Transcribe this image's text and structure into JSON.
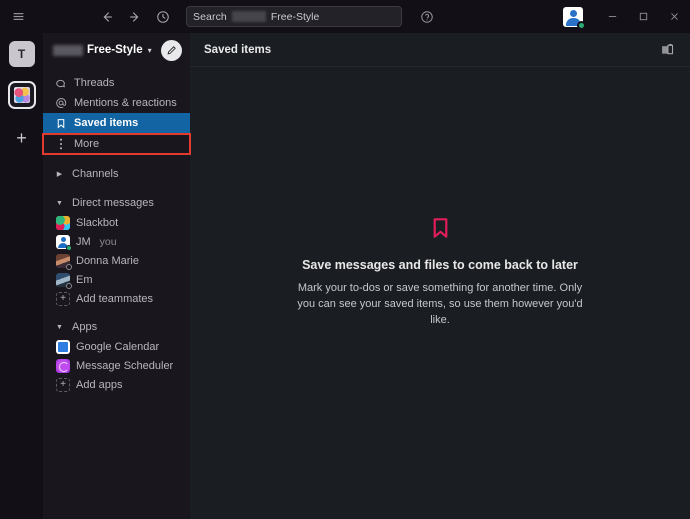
{
  "window": {
    "menu_icon": "hamburger-icon",
    "back_icon": "arrow-left-icon",
    "forward_icon": "arrow-right-icon",
    "history_icon": "clock-icon",
    "help_icon": "question-mark-icon",
    "minimize_label": "—",
    "maximize_label": "□",
    "close_label": "✕"
  },
  "search": {
    "label": "Search",
    "redacted": "",
    "workspace": "Free-Style",
    "placeholder": "Search Free-Style"
  },
  "rail": {
    "workspace_initial": "T",
    "active_workspace_icon": "workspace-avatar-icon",
    "add_label": "+"
  },
  "sidebar": {
    "workspace_redacted": "",
    "workspace_name": "Free-Style",
    "caret": "▾",
    "compose_icon": "compose-pencil-icon",
    "nav": [
      {
        "label": "Threads",
        "icon": "threads-icon",
        "active": false
      },
      {
        "label": "Mentions & reactions",
        "icon": "at-sign-icon",
        "active": false
      },
      {
        "label": "Saved items",
        "icon": "bookmark-icon",
        "active": true
      },
      {
        "label": "More",
        "icon": "more-vertical-dots-icon",
        "active": false,
        "highlighted": true
      }
    ],
    "channels": {
      "label": "Channels",
      "expanded": false
    },
    "direct_messages": {
      "label": "Direct messages",
      "expanded": true,
      "items": [
        {
          "name": "Slackbot",
          "suffix": "",
          "presence": "none"
        },
        {
          "name": "JM",
          "suffix": "you",
          "presence": "online"
        },
        {
          "name": "Donna Marie",
          "suffix": "",
          "presence": "offline"
        },
        {
          "name": "Em",
          "suffix": "",
          "presence": "offline"
        }
      ],
      "add_label": "Add teammates"
    },
    "apps": {
      "label": "Apps",
      "expanded": true,
      "items": [
        {
          "name": "Google Calendar",
          "icon": "google-calendar-icon"
        },
        {
          "name": "Message Scheduler",
          "icon": "message-scheduler-icon"
        }
      ],
      "add_label": "Add apps"
    }
  },
  "main": {
    "title": "Saved items",
    "header_icon": "files-icon",
    "empty_icon": "bookmark-outline-icon",
    "empty_title": "Save messages and files to come back to later",
    "empty_desc": "Mark your to-dos or save something for another time. Only you can see your saved items, so use them however you'd like."
  },
  "colors": {
    "accent_blue": "#1264a3",
    "highlight_red": "#e23a2e",
    "bookmark_pink": "#e01e5a",
    "sidebar_bg": "#19171d",
    "main_bg": "#1a1d21",
    "titlebar_bg": "#121016",
    "presence_green": "#2bac76"
  }
}
